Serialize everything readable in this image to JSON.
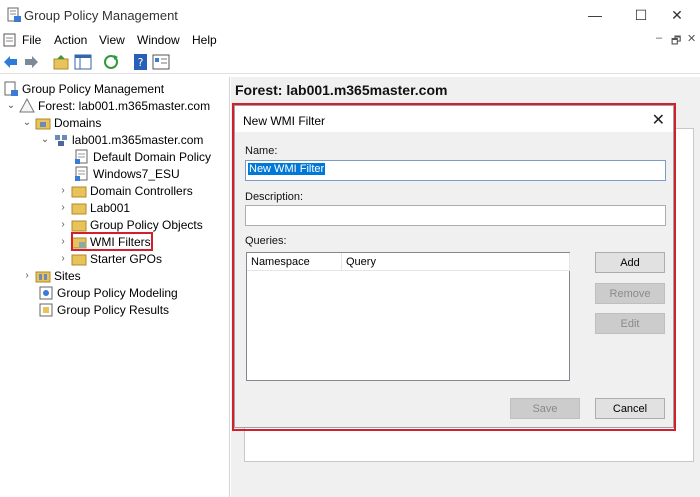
{
  "window": {
    "title": "Group Policy Management",
    "min_glyph": "—",
    "max_glyph": "☐",
    "close_glyph": "✕"
  },
  "menu": {
    "items": [
      "File",
      "Action",
      "View",
      "Window",
      "Help"
    ],
    "right_min": "–",
    "right_restore": "🗗",
    "right_close": "✕"
  },
  "tree": {
    "root": "Group Policy Management",
    "forest": "Forest: lab001.m365master.com",
    "domains": "Domains",
    "domain": "lab001.m365master.com",
    "default_policy": "Default Domain Policy",
    "win7": "Windows7_ESU",
    "dcs": "Domain Controllers",
    "lab": "Lab001",
    "gpo": "Group Policy Objects",
    "wmi": "WMI Filters",
    "starter": "Starter GPOs",
    "sites": "Sites",
    "modeling": "Group Policy Modeling",
    "results": "Group Policy Results"
  },
  "right": {
    "header": "Forest: lab001.m365master.com"
  },
  "dialog": {
    "title": "New WMI Filter",
    "close_glyph": "✕",
    "name_label": "Name:",
    "name_value": "New WMI Filter",
    "description_label": "Description:",
    "description_value": "",
    "queries_label": "Queries:",
    "columns": [
      "Namespace",
      "Query"
    ],
    "add_label": "Add",
    "remove_label": "Remove",
    "edit_label": "Edit",
    "save_label": "Save",
    "cancel_label": "Cancel"
  },
  "colors": {
    "highlight": "#d21f2b",
    "selection": "#0078d7"
  }
}
